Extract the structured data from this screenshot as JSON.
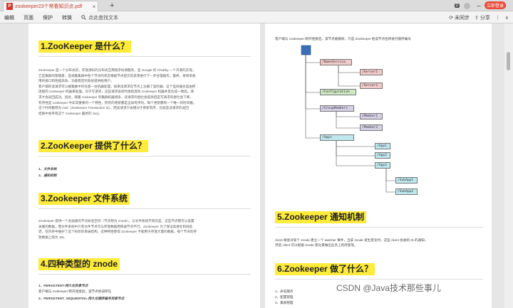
{
  "titlebar": {
    "tab_title": "zookeeper23个常看知识点.pdf",
    "pdf_label": "P",
    "new_tab": "+",
    "badge": "2",
    "minimize": "─",
    "maximize": "□",
    "close": "✕"
  },
  "toolbar": {
    "menu": [
      "编辑",
      "页面",
      "保护",
      "转换"
    ],
    "search_label": "点此查找文本",
    "sync_label": "未同步",
    "share_label": "分享",
    "login_label": "立即登录"
  },
  "left_page": {
    "h1": "1.ZooKeeper 是什么？",
    "p1_line1": "ZooKeeper 是一个分布式的，开放源码的分布式应用程序协调服务，是 Google 的 Chubby 一个开源的实现，",
    "p1_line2": "它是集群的管理者，监视着集群中各个节点的状态根据节点提交的反馈进行下一步合理操作。最终，将简单易",
    "p1_line3": "用的接口和性能高效、功能稳定的系统提供给用户。",
    "p1_line4": "客户端的读请求可以被集群中的任意一台机器处理，如果读请求在节点上注册了监听器，这个监听器也是由所",
    "p1_line5": "连接的 zookeeper 机器来处理。对于写请求，这些请求会同时发给其他 zookeeper 机器并且达成一致后，请",
    "p1_line6": "求才会返回成功。因此，随着 zookeeper 的集群机器增多，读请求的吞吐会提高但是写请求的吞吐会下降。",
    "p1_line7": "有序性是 zookeeper 中非常重要的一个特性，所有的更新都是全局有序的，每个更新都有一个唯一的时间戳，",
    "p1_line8": "这个时间戳称为 zxid（Zookeeper Transaction Id）。而读请求只会相对于更新有序，也就是读请求的返回",
    "p1_line9": "结果中会带有这个 zookeeper 最新的 zxid。",
    "h2": "2.ZooKeeper 提供了什么？",
    "list2": [
      "1、文件系统",
      "2、通知机制"
    ],
    "h3": "3.Zookeeper 文件系统",
    "p3_line1": "Zookeeper 提供一个多层级的节点命名空间（节点称为 znode）。与文件系统不同的是，这些节点都可以设置",
    "p3_line2": "关联的数据，而文件系统中只有文件节点可以存放数据而目录节点不行。Zookeeper 为了保证高吞吐和低延",
    "p3_line3": "迟，在内存中维护了这个树状的目录结构，这种特性使得 Zookeeper 不能用于存放大量的数据，每个节点的存",
    "p3_line4": "放数据上限为 1M。",
    "h4": "4.四种类型的 znode",
    "list4_1": "1、PERSISTENT-持久化目录节点",
    "list4_2": "客户端与 zookeeper 断开连接后，该节点依旧存在",
    "list4_3": "2、PERSISTENT_SEQUENTIAL-持久化顺序编号目录节点"
  },
  "right_page": {
    "intro": "客户端与 zookeeper 断开连接后，该节点被删除，只是 Zookeeper 给该节点名称进行顺序编号",
    "tree": {
      "nameservice": "/NameService",
      "server1a": "/Server1",
      "server1b": "/Server1",
      "configuration": "/Configuration",
      "groupmembers": "/GroupMembers",
      "member1": "/Member1",
      "member2": "/Member2",
      "apps": "/Apps",
      "app1": "/App1",
      "app2": "/App2",
      "app3": "/App3",
      "subapp1": "/SubApp1",
      "subapp2": "/SubApp2"
    },
    "h5": "5.Zookeeper 通知机制",
    "p5_line1": "client 端会对某个 znode 建立一个 watcher 事件，当该 znode 发生变化时，这些 client 会收到 zk 的通知，",
    "p5_line2": "然后 client 可以根据 znode 变化来做出业务上的改变等。",
    "h6": "6.Zookeeper 做了什么？",
    "list6": [
      "1、命名服务",
      "2、配置管理",
      "3、集群管理"
    ]
  },
  "watermark": "CSDN @Java技术那些事儿",
  "colors": {
    "heading_highlight": "#ffeb3b",
    "accent_red": "#c0392b",
    "node_red_fill": "#f2c9c9",
    "node_green_fill": "#cde8c4",
    "node_purple_fill": "#d6d0e6",
    "node_cyan_fill": "#bfe8ee",
    "root_blue": "#3a6fb5"
  }
}
